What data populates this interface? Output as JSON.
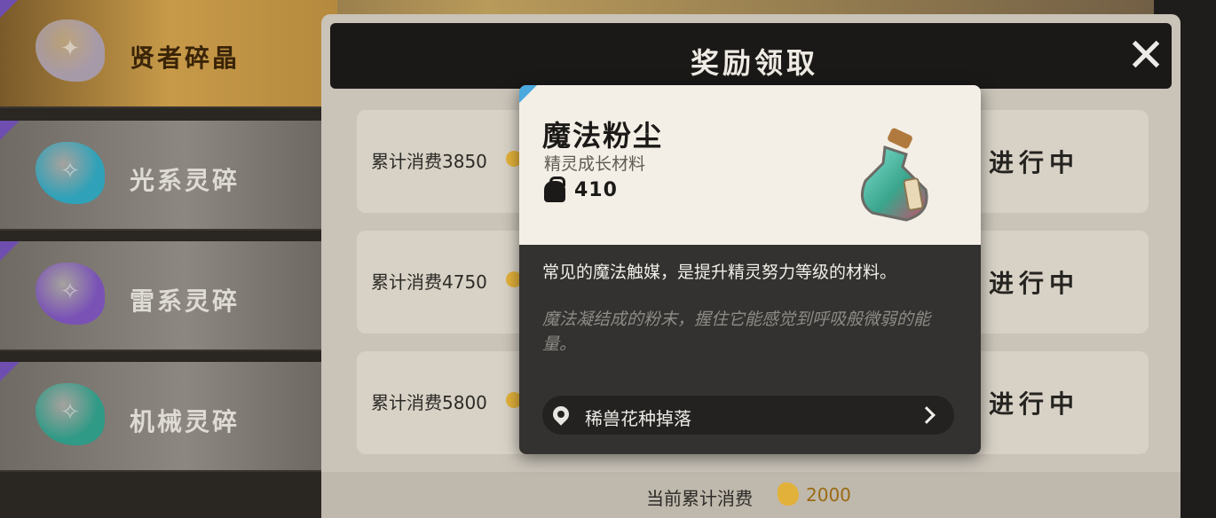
{
  "left_list": {
    "items": [
      {
        "name": "贤者碎晶",
        "badge": "",
        "crystal_color": "#a79aa8",
        "glyph": "✦",
        "selected": true
      },
      {
        "name": "光系灵碎",
        "badge": "",
        "crystal_color": "#2fa1b8",
        "glyph": "✧",
        "selected": false
      },
      {
        "name": "雷系灵碎",
        "badge": "",
        "crystal_color": "#7a52b6",
        "glyph": "✧",
        "selected": false
      },
      {
        "name": "机械灵碎",
        "badge": "",
        "crystal_color": "#2f9a86",
        "glyph": "✧",
        "selected": false
      }
    ]
  },
  "panel": {
    "title": "奖励领取",
    "rows": [
      {
        "label": "累计消费3850",
        "status": "进行中"
      },
      {
        "label": "累计消费4750",
        "status": "进行中"
      },
      {
        "label": "累计消费5800",
        "status": "进行中"
      }
    ],
    "footer_label": "当前累计消费",
    "footer_value": "2000"
  },
  "tooltip": {
    "item_name": "魔法粉尘",
    "item_category": "精灵成长材料",
    "item_count": "410",
    "description": "常见的魔法触媒，是提升精灵努力等级的材料。",
    "lore": "魔法凝结成的粉末，握住它能感觉到呼吸般微弱的能量。",
    "source_label": "稀兽花种掉落"
  },
  "colors": {
    "accent_gold": "#e2b13a",
    "corner_blue": "#4aa9de",
    "corner_purple": "#6e4fb0"
  },
  "icons": [
    "close-icon",
    "coin-icon",
    "bag-icon",
    "potion-icon",
    "location-pin-icon",
    "chevron-right-icon"
  ]
}
